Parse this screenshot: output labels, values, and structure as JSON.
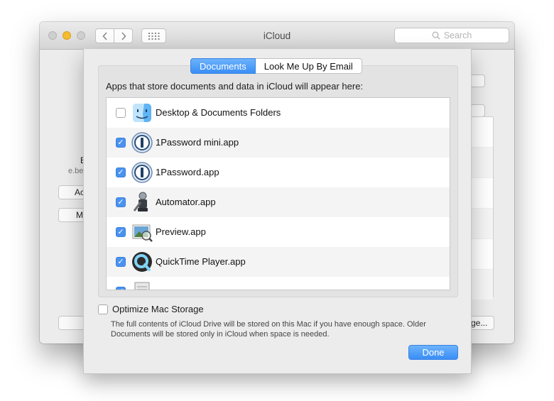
{
  "window": {
    "title": "iCloud",
    "search_placeholder": "Search"
  },
  "background": {
    "partial_name": "E",
    "partial_email": "e.be",
    "btn_account": "Ac",
    "btn_manage": "M",
    "btn_storage": "ge..."
  },
  "sheet": {
    "tabs": [
      {
        "label": "Documents",
        "active": true
      },
      {
        "label": "Look Me Up By Email",
        "active": false
      }
    ],
    "description": "Apps that store documents and data in iCloud will appear here:",
    "apps": [
      {
        "label": "Desktop & Documents Folders",
        "checked": false,
        "icon": "finder-icon"
      },
      {
        "label": "1Password mini.app",
        "checked": true,
        "icon": "1password-icon"
      },
      {
        "label": "1Password.app",
        "checked": true,
        "icon": "1password-icon"
      },
      {
        "label": "Automator.app",
        "checked": true,
        "icon": "automator-icon"
      },
      {
        "label": "Preview.app",
        "checked": true,
        "icon": "preview-icon"
      },
      {
        "label": "QuickTime Player.app",
        "checked": true,
        "icon": "quicktime-icon"
      },
      {
        "label": "",
        "checked": true,
        "icon": "script-editor-icon"
      }
    ],
    "optimize_label": "Optimize Mac Storage",
    "optimize_checked": false,
    "optimize_note": "The full contents of iCloud Drive will be stored on this Mac if you have enough space. Older Documents will be stored only in iCloud when space is needed.",
    "done_label": "Done"
  },
  "colors": {
    "accent": "#3a8ef6",
    "checkbox_on": "#4a92f0"
  }
}
